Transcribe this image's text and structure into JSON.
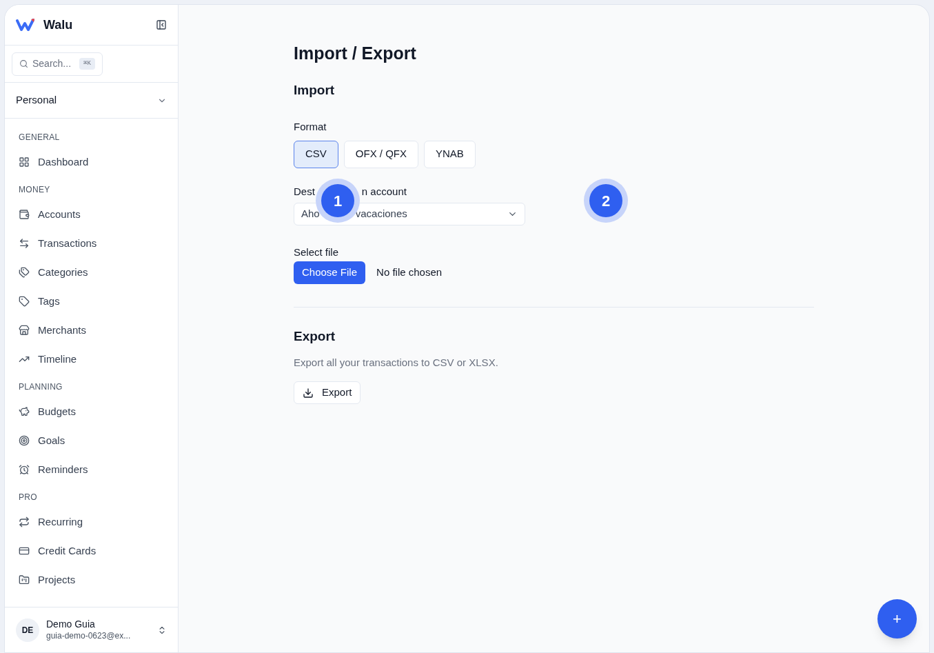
{
  "sidebar": {
    "brand": "Walu",
    "search": {
      "placeholder": "Search...",
      "shortcut": "⌘K"
    },
    "workspace": "Personal",
    "sections": [
      {
        "title": "GENERAL",
        "items": [
          {
            "label": "Dashboard"
          }
        ]
      },
      {
        "title": "MONEY",
        "items": [
          {
            "label": "Accounts"
          },
          {
            "label": "Transactions"
          },
          {
            "label": "Categories"
          },
          {
            "label": "Tags"
          },
          {
            "label": "Merchants"
          },
          {
            "label": "Timeline"
          }
        ]
      },
      {
        "title": "PLANNING",
        "items": [
          {
            "label": "Budgets"
          },
          {
            "label": "Goals"
          },
          {
            "label": "Reminders"
          }
        ]
      },
      {
        "title": "PRO",
        "items": [
          {
            "label": "Recurring"
          },
          {
            "label": "Credit Cards"
          },
          {
            "label": "Projects"
          }
        ]
      }
    ],
    "user": {
      "initials": "DE",
      "name": "Demo Guia",
      "email": "guia-demo-0623@ex..."
    }
  },
  "page": {
    "title": "Import / Export",
    "import": {
      "heading": "Import",
      "format_label": "Format",
      "formats": [
        {
          "label": "CSV",
          "selected": true
        },
        {
          "label": "OFX / QFX",
          "selected": false
        },
        {
          "label": "YNAB",
          "selected": false
        }
      ],
      "destination": {
        "label_parts": [
          "Dest",
          "n account"
        ],
        "value_parts": [
          "Aho",
          "vacaciones"
        ]
      },
      "file": {
        "label": "Select file",
        "button": "Choose File",
        "status": "No file chosen"
      }
    },
    "export": {
      "heading": "Export",
      "description": "Export all your transactions to CSV or XLSX.",
      "button": "Export"
    }
  },
  "markers": [
    "1",
    "2"
  ],
  "fab": "+"
}
